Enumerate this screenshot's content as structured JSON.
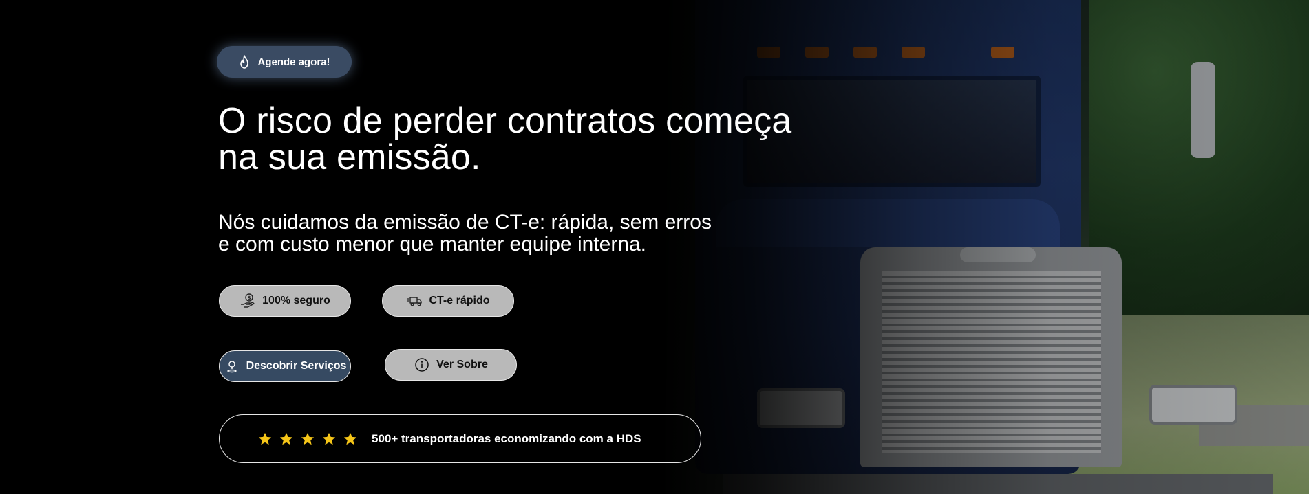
{
  "hero": {
    "cta_label": "Agende agora!",
    "headline_line1": "O risco de perder contratos começa",
    "headline_line2": "na sua emissão.",
    "subline_line1": "Nós cuidamos da emissão de CT-e: rápida, sem erros",
    "subline_line2": "e com custo menor que manter equipe interna."
  },
  "features": [
    {
      "label": "100% seguro",
      "icon": "money-hand-icon"
    },
    {
      "label": "CT-e rápido",
      "icon": "fast-truck-icon"
    }
  ],
  "actions": {
    "servicos_label": "Descobrir Serviços",
    "servicos_icon": "location-pin-icon",
    "sobre_label": "Ver Sobre",
    "sobre_icon": "info-icon"
  },
  "rating": {
    "stars": 5,
    "text": "500+ transportadoras economizando com a HDS"
  },
  "colors": {
    "background": "#000000",
    "star": "#f5c518",
    "dark_button": "#364a62",
    "light_chip": "#b9b9b9",
    "cta_pill": "#3a4b63"
  }
}
